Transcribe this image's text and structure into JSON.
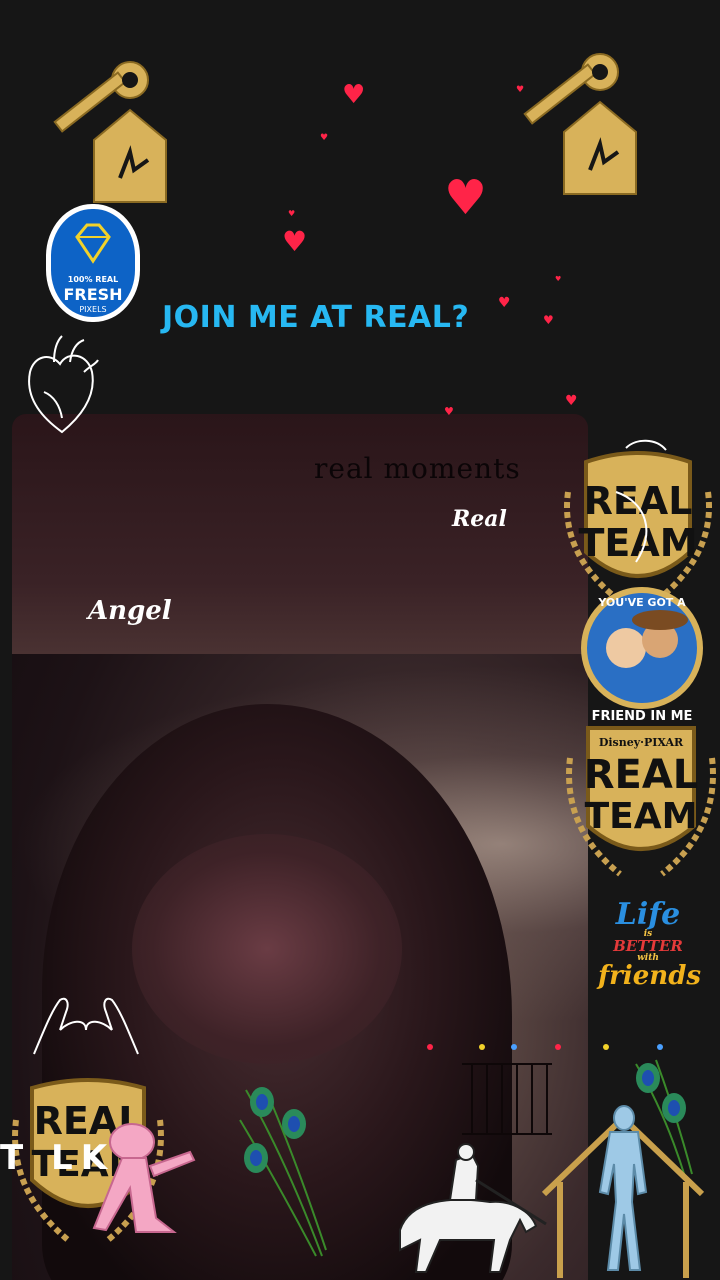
{
  "headline": "JOIN ME AT REAL?",
  "labels": {
    "angel": "Angel",
    "real": "Real",
    "moments": "real moments",
    "talk": "T  LK"
  },
  "stickers": {
    "fresh_badge": {
      "line1": "100% REAL",
      "line2": "FRESH",
      "line3": "PIXELS"
    },
    "real_team_top": {
      "line1": "REAL",
      "line2": "TEAM"
    },
    "friend_ring": {
      "top": "YOU'VE GOT A",
      "bottom": "FRIEND IN ME"
    },
    "real_team_mid": {
      "brand": "Disney·PIXAR",
      "line1": "REAL",
      "line2": "TEAM"
    },
    "life_better": {
      "l1": "Life",
      "l2": "is",
      "l3": "BETTER",
      "l4": "with",
      "l5": "friends"
    },
    "real_team_bottom": {
      "line1": "REAL",
      "line2": "TEAM"
    }
  },
  "colors": {
    "background": "#161616",
    "accent": "#27b8f2",
    "heart": "#ff2448",
    "gold": "#d8b25a"
  },
  "icons": [
    "key-house-icon",
    "heart-icon",
    "anatomical-heart-icon",
    "pinky-promise-icon",
    "peacock-feather-icon",
    "knight-horse-icon",
    "house-outline-icon",
    "figure-icon"
  ]
}
